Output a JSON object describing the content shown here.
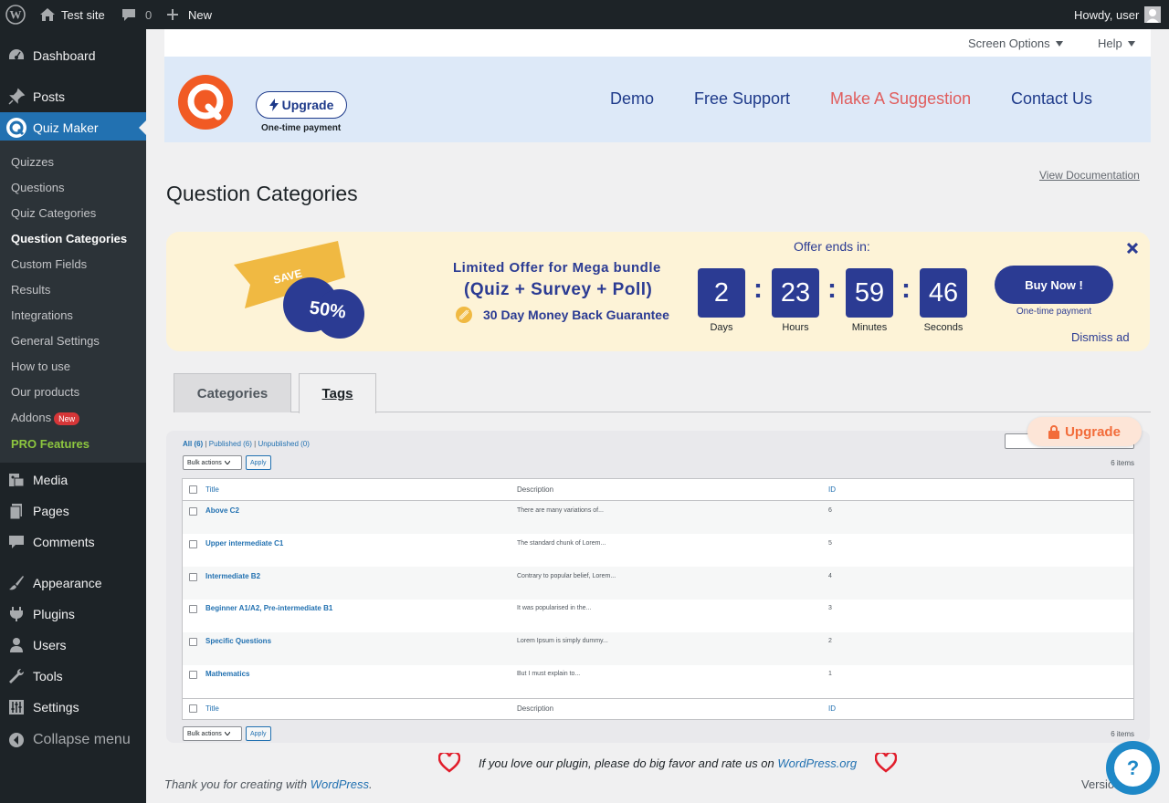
{
  "adminbar": {
    "site_name": "Test site",
    "comments_count": "0",
    "new_label": "New",
    "greeting": "Howdy, user"
  },
  "sidebar": {
    "top": [
      {
        "label": "Dashboard",
        "icon": "dashboard-icon"
      },
      {
        "label": "Posts",
        "icon": "pin-icon"
      },
      {
        "label": "Quiz Maker",
        "icon": "quiz-maker-icon"
      }
    ],
    "quiz_submenu": [
      "Quizzes",
      "Questions",
      "Quiz Categories",
      "Question Categories",
      "Custom Fields",
      "Results",
      "Integrations",
      "General Settings",
      "How to use",
      "Our products"
    ],
    "addons_label": "Addons",
    "addons_badge": "New",
    "pro_label": "PRO Features",
    "bottom": [
      "Media",
      "Pages",
      "Comments",
      "Appearance",
      "Plugins",
      "Users",
      "Tools",
      "Settings",
      "Collapse menu"
    ]
  },
  "screen_options": {
    "label": "Screen Options",
    "help": "Help"
  },
  "header": {
    "upgrade_label": "Upgrade",
    "one_time": "One-time payment",
    "links": [
      "Demo",
      "Free Support",
      "Make A Suggestion",
      "Contact Us"
    ]
  },
  "page": {
    "title": "Question Categories",
    "view_doc": "View Documentation"
  },
  "promo": {
    "save": "SAVE",
    "percent": "50%",
    "headline": "Limited Offer for Mega bundle",
    "bundle": "(Quiz + Survey + Poll)",
    "guarantee": "30 Day Money Back Guarantee",
    "offer_ends": "Offer ends in:",
    "countdown": [
      {
        "value": "2",
        "label": "Days"
      },
      {
        "value": "23",
        "label": "Hours"
      },
      {
        "value": "59",
        "label": "Minutes"
      },
      {
        "value": "46",
        "label": "Seconds"
      }
    ],
    "buy_label": "Buy Now !",
    "buy_sub": "One-time payment",
    "dismiss": "Dismiss ad"
  },
  "tabs": [
    "Categories",
    "Tags"
  ],
  "table": {
    "filters": {
      "all": "All (6)",
      "published": "Published (6)",
      "unpublished": "Unpublished (0)"
    },
    "bulk": "Bulk actions",
    "apply": "Apply",
    "items": "6 items",
    "columns": [
      "Title",
      "Description",
      "ID"
    ],
    "rows": [
      {
        "title": "Above C2",
        "desc": "There are many variations of...",
        "id": "6"
      },
      {
        "title": "Upper intermediate C1",
        "desc": "The standard chunk of Lorem...",
        "id": "5"
      },
      {
        "title": "Intermediate B2",
        "desc": "Contrary to popular belief, Lorem...",
        "id": "4"
      },
      {
        "title": "Beginner A1/A2, Pre-intermediate B1",
        "desc": "It was popularised in the...",
        "id": "3"
      },
      {
        "title": "Specific Questions",
        "desc": "Lorem Ipsum is simply dummy...",
        "id": "2"
      },
      {
        "title": "Mathematics",
        "desc": "But I must explain to...",
        "id": "1"
      }
    ],
    "upgrade_label": "Upgrade"
  },
  "rate": {
    "text": "If you love our plugin, please do big favor and rate us on",
    "link": "WordPress.org"
  },
  "footer": {
    "text": "Thank you for creating with",
    "link": "WordPress",
    "version": "Versio"
  }
}
